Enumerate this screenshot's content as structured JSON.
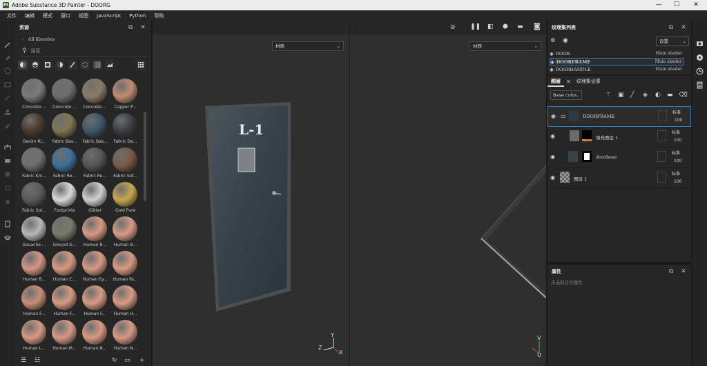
{
  "titlebar": {
    "title": "Adobe Substance 3D Painter - DOORG",
    "app_icon": "Pt"
  },
  "menu": [
    "文件",
    "编辑",
    "模式",
    "窗口",
    "视图",
    "JavaScript",
    "Python",
    "帮助"
  ],
  "assets": {
    "title": "资源",
    "all_libraries": "All libraries",
    "search_placeholder": "搜索",
    "materials": [
      {
        "label": "Concrete ...",
        "color": "#7a7a78"
      },
      {
        "label": "Concrete ...",
        "color": "#6e6e6d"
      },
      {
        "label": "Concrete ...",
        "color": "#8a7b66"
      },
      {
        "label": "Copper P...",
        "color": "#c08b72"
      },
      {
        "label": "Denim Ri...",
        "color": "#4a3a2e"
      },
      {
        "label": "Fabric Bas...",
        "color": "#7e7550"
      },
      {
        "label": "Fabric Bas...",
        "color": "#3e5566"
      },
      {
        "label": "Fabric De...",
        "color": "#3b3e42"
      },
      {
        "label": "Fabric Kni...",
        "color": "#6f6f6f"
      },
      {
        "label": "Fabric Ro...",
        "color": "#3f6f9a"
      },
      {
        "label": "Fabric Ro...",
        "color": "#555555"
      },
      {
        "label": "Fabric Sof...",
        "color": "#7a5a48"
      },
      {
        "label": "Fabric Sui...",
        "color": "#5a5a5a"
      },
      {
        "label": "Footprints",
        "color": "#d9d9d9"
      },
      {
        "label": "Glitter",
        "color": "#cfcfcf"
      },
      {
        "label": "Gold Pure",
        "color": "#c7a64e"
      },
      {
        "label": "Gouache ...",
        "color": "#b7b7b7"
      },
      {
        "label": "Ground G...",
        "color": "#7a7a6a"
      },
      {
        "label": "Human B...",
        "color": "#d79a84"
      },
      {
        "label": "Human B...",
        "color": "#d79a84"
      },
      {
        "label": "Human B...",
        "color": "#d39684"
      },
      {
        "label": "Human C...",
        "color": "#d79a84"
      },
      {
        "label": "Human Ey...",
        "color": "#d79a84"
      },
      {
        "label": "Human Fa...",
        "color": "#d79a84"
      },
      {
        "label": "Human F...",
        "color": "#c78e78"
      },
      {
        "label": "Human F...",
        "color": "#d79a84"
      },
      {
        "label": "Human F...",
        "color": "#d79a84"
      },
      {
        "label": "Human H...",
        "color": "#d79a84"
      },
      {
        "label": "Human L...",
        "color": "#d79a84"
      },
      {
        "label": "Human M...",
        "color": "#d79a84"
      },
      {
        "label": "Human N...",
        "color": "#d79a84"
      },
      {
        "label": "Human N...",
        "color": "#d79a84"
      }
    ]
  },
  "viewport": {
    "left_dropdown": "材质",
    "right_dropdown": "材质",
    "door_label": "L-1",
    "axis_x": "Z",
    "axis_y": "Y",
    "axis_z": "X",
    "axis_y2": "V",
    "axis_x2": "U"
  },
  "texture_sets": {
    "title": "纹理集列表",
    "settings": "设置",
    "items": [
      {
        "name": "DOOR",
        "shader": "Main shader"
      },
      {
        "name": "DOORFRAME",
        "shader": "Main shader"
      },
      {
        "name": "DOORHANDLE",
        "shader": "Main shader"
      }
    ]
  },
  "layers": {
    "tab_layers": "图层",
    "tab_settings": "纹理集设置",
    "channel": "Base color",
    "rows": [
      {
        "name": "DOORFRAME",
        "blend": "标准",
        "opacity": "100"
      },
      {
        "name": "填充图层 1",
        "blend": "标准",
        "opacity": "100"
      },
      {
        "name": "doorbase",
        "blend": "标准",
        "opacity": "100"
      },
      {
        "name": "图层 1",
        "blend": "标准",
        "opacity": "100"
      }
    ]
  },
  "properties": {
    "title": "属性",
    "empty": "未选取任何属性"
  }
}
